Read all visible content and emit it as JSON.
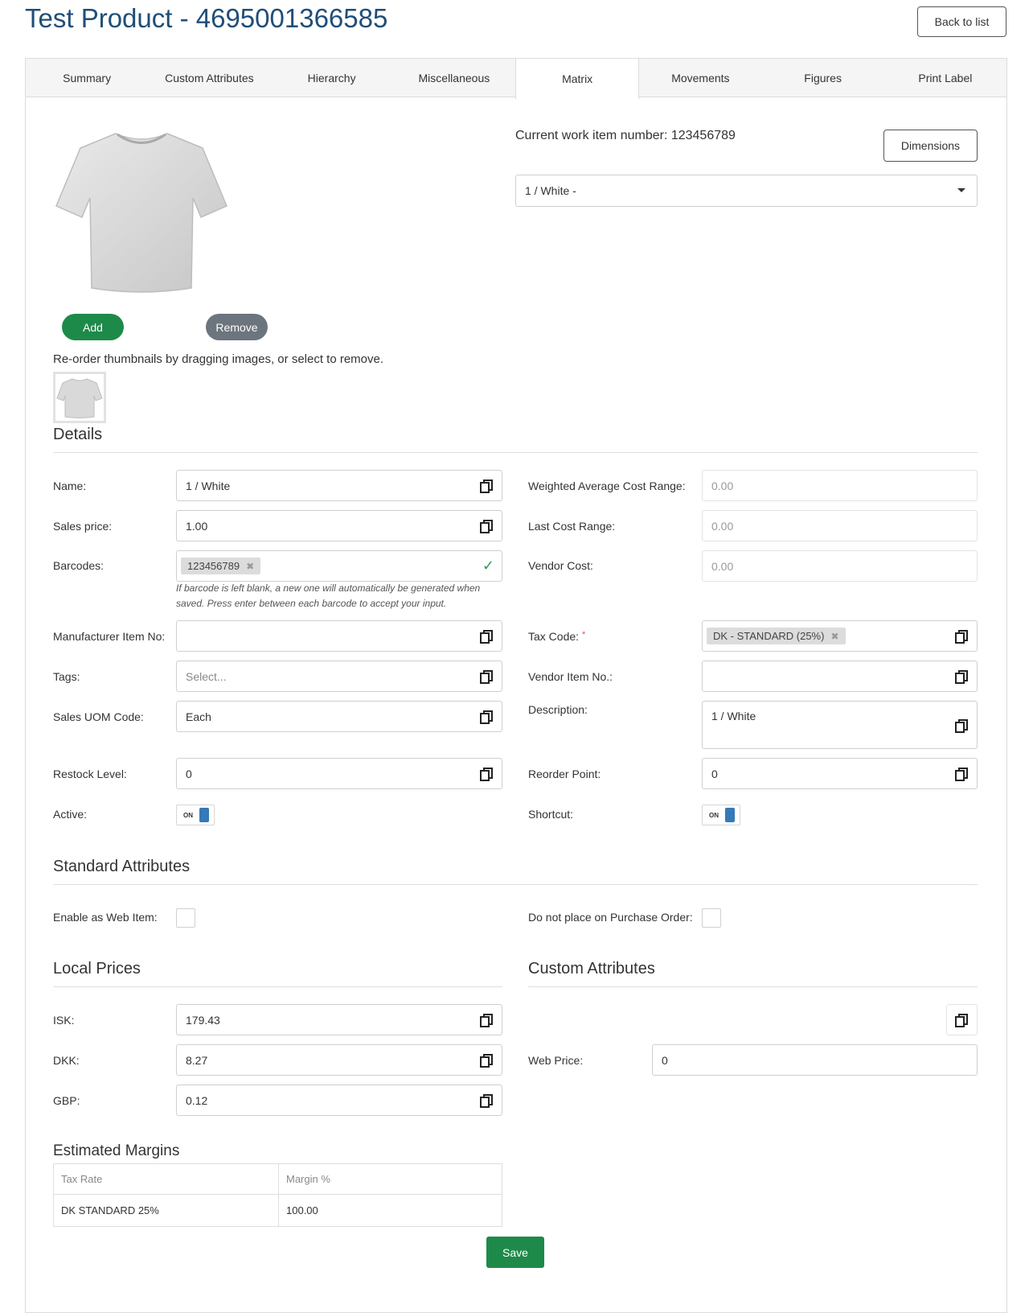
{
  "page": {
    "title": "Test Product - 4695001366585",
    "back_label": "Back to list"
  },
  "tabs": [
    "Summary",
    "Custom Attributes",
    "Hierarchy",
    "Miscellaneous",
    "Matrix",
    "Movements",
    "Figures",
    "Print Label"
  ],
  "active_tab": "Matrix",
  "image_panel": {
    "add_label": "Add",
    "remove_label": "Remove",
    "reorder_hint": "Re-order thumbnails by dragging images, or select to remove."
  },
  "work_item": {
    "text": "Current work item number: 123456789",
    "dimensions_label": "Dimensions",
    "variant_selected": "1 / White -"
  },
  "details": {
    "title": "Details",
    "name_label": "Name:",
    "name_value": "1 / White",
    "sales_price_label": "Sales price:",
    "sales_price_value": "1.00",
    "barcodes_label": "Barcodes:",
    "barcode_chip": "123456789",
    "barcode_hint_1": "If barcode is left blank, a new one will automatically be generated when",
    "barcode_hint_2": "saved. Press enter between each barcode to accept your input.",
    "manufacturer_label": "Manufacturer Item No:",
    "manufacturer_value": "",
    "tags_label": "Tags:",
    "tags_placeholder": "Select...",
    "uom_label": "Sales UOM Code:",
    "uom_value": "Each",
    "restock_label": "Restock Level:",
    "restock_value": "0",
    "active_label": "Active:",
    "active_toggle": "ON",
    "wac_label": "Weighted Average Cost Range:",
    "wac_value": "0.00",
    "last_cost_label": "Last Cost Range:",
    "last_cost_value": "0.00",
    "vendor_cost_label": "Vendor Cost:",
    "vendor_cost_value": "0.00",
    "tax_code_label": "Tax Code:",
    "tax_code_required": "*",
    "tax_code_chip": "DK - STANDARD (25%)",
    "vendor_item_label": "Vendor Item No.:",
    "vendor_item_value": "",
    "description_label": "Description:",
    "description_value": "1 / White",
    "reorder_label": "Reorder Point:",
    "reorder_value": "0",
    "shortcut_label": "Shortcut:",
    "shortcut_toggle": "ON"
  },
  "standard_attributes": {
    "title": "Standard Attributes",
    "web_item_label": "Enable as Web Item:",
    "no_po_label": "Do not place on Purchase Order:"
  },
  "local_prices": {
    "title": "Local Prices",
    "rows": [
      {
        "label": "ISK:",
        "value": "179.43"
      },
      {
        "label": "DKK:",
        "value": "8.27"
      },
      {
        "label": "GBP:",
        "value": "0.12"
      }
    ]
  },
  "custom_attributes": {
    "title": "Custom Attributes",
    "web_price_label": "Web Price:",
    "web_price_value": "0"
  },
  "estimated_margins": {
    "title": "Estimated Margins",
    "headers": [
      "Tax Rate",
      "Margin %"
    ],
    "rows": [
      [
        "DK STANDARD 25%",
        "100.00"
      ]
    ]
  },
  "save_label": "Save",
  "colors": {
    "title": "#1f4e79",
    "add_button": "#1e8a4a",
    "remove_button": "#6c757d",
    "save_button": "#1e8a4a",
    "toggle_on": "#337ab7",
    "check": "#2e9e5b"
  }
}
